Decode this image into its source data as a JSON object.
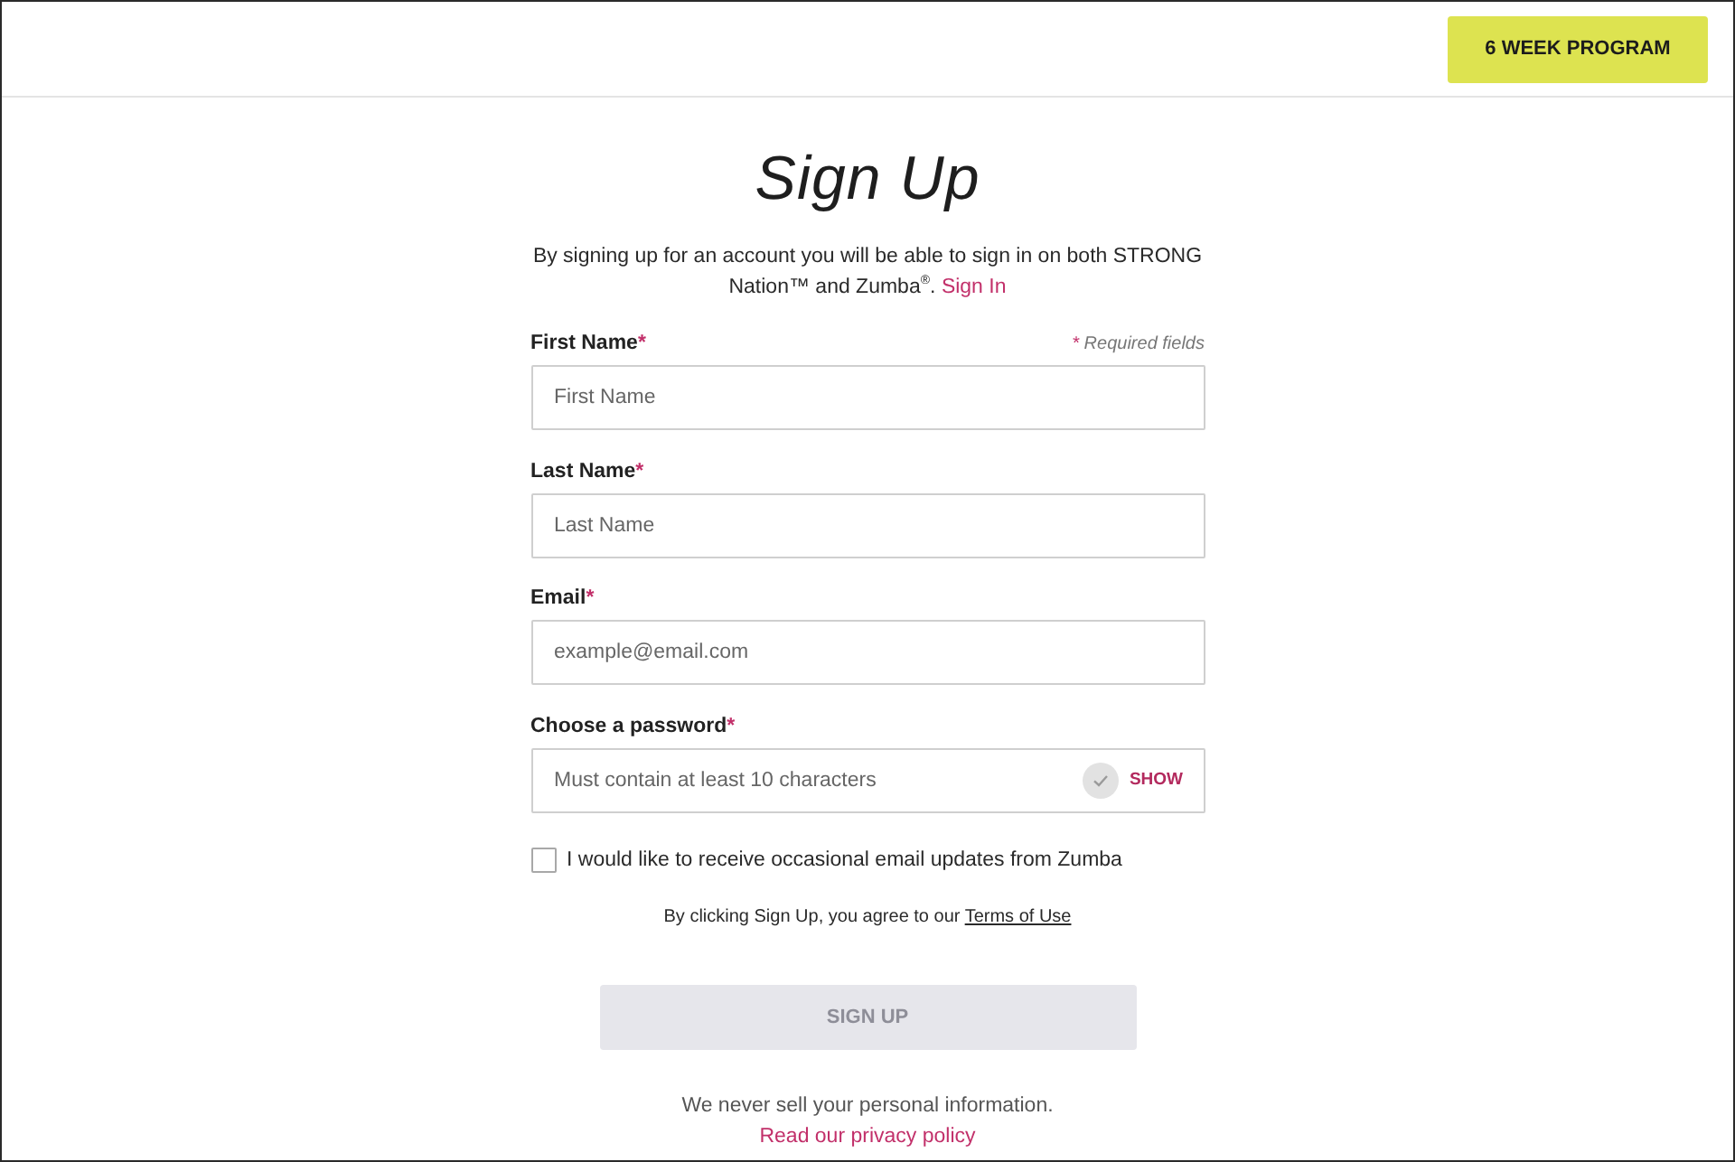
{
  "header": {
    "program_button": "6 WEEK PROGRAM"
  },
  "title": "Sign Up",
  "intro": {
    "text": "By signing up for an account you will be able to sign in on both STRONG Nation™ and Zumba$^{®}$.",
    "link": "Sign In"
  },
  "required_note": {
    "mark": "*",
    "text": "Required fields"
  },
  "fields": [
    {
      "kind": "text",
      "label": "First Name",
      "required_mark": "*",
      "placeholder": "First Name"
    },
    {
      "kind": "text",
      "label": "Last Name",
      "required_mark": "*",
      "placeholder": "Last Name"
    },
    {
      "kind": "email",
      "label": "Email",
      "required_mark": "*",
      "placeholder": "example@email.com"
    },
    {
      "kind": "password",
      "label": "Choose a password",
      "required_mark": "*",
      "placeholder": "Must contain at least 10 characters",
      "valid": false,
      "toggle": "SHOW"
    }
  ],
  "newsletter": {
    "label": "I would like to receive occasional email updates from Zumba",
    "checked": false
  },
  "terms": {
    "text": "By clicking Sign Up, you agree to our",
    "link": "Terms of Use"
  },
  "submit": {
    "label": "SIGN UP",
    "disabled": true
  },
  "footer": {
    "text": "We never sell your personal information.",
    "link": "Read our privacy policy"
  }
}
